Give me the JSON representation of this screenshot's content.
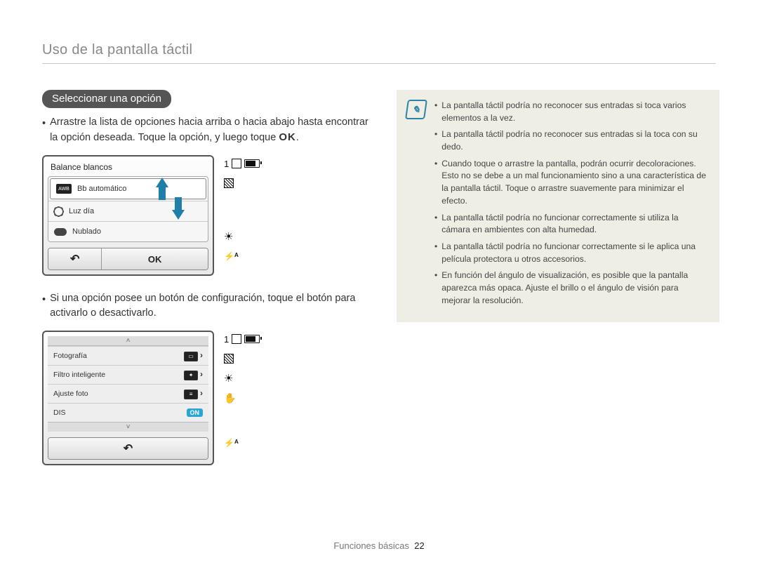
{
  "breadcrumb": "Uso de la pantalla táctil",
  "section_badge": "Seleccionar una opción",
  "para1_lead": "Arrastre la lista de opciones hacia arriba o hacia abajo hasta encontrar la opción deseada. Toque la opción, y luego toque",
  "ok_label_inline": "OK",
  "period": ".",
  "screenshot1": {
    "title": "Balance blancos",
    "opt1": "Bb automático",
    "opt2": "Luz día",
    "opt3": "Nublado",
    "back": "↶",
    "ok": "OK",
    "awb_icon_text": "AWB",
    "side_count": "1"
  },
  "para2": "Si una opción posee un botón de configuración, toque el botón para activarlo o desactivarlo.",
  "screenshot2": {
    "row1": "Fotografía",
    "row2": "Filtro inteligente",
    "row3": "Ajuste foto",
    "row4": "DIS",
    "on": "ON",
    "nav_up": "˄",
    "nav_down": "˅",
    "back": "↶",
    "side_count": "1"
  },
  "notes": {
    "n1": "La pantalla táctil podría no reconocer sus entradas si toca varios elementos a la vez.",
    "n2": "La pantalla táctil podría no reconocer sus entradas si la toca con su dedo.",
    "n3": "Cuando toque o arrastre la pantalla, podrán ocurrir decoloraciones. Esto no se debe a un mal funcionamiento sino a una característica de la pantalla táctil. Toque o arrastre suavemente para minimizar el efecto.",
    "n4": "La pantalla táctil podría no funcionar correctamente si utiliza la cámara en ambientes con alta humedad.",
    "n5": "La pantalla táctil podría no funcionar correctamente si le aplica una película protectora u otros accesorios.",
    "n6": "En función del ángulo de visualización, es posible que la pantalla aparezca más opaca. Ajuste el brillo o el ángulo de visión para mejorar la resolución."
  },
  "footer_section": "Funciones básicas",
  "footer_page": "22"
}
